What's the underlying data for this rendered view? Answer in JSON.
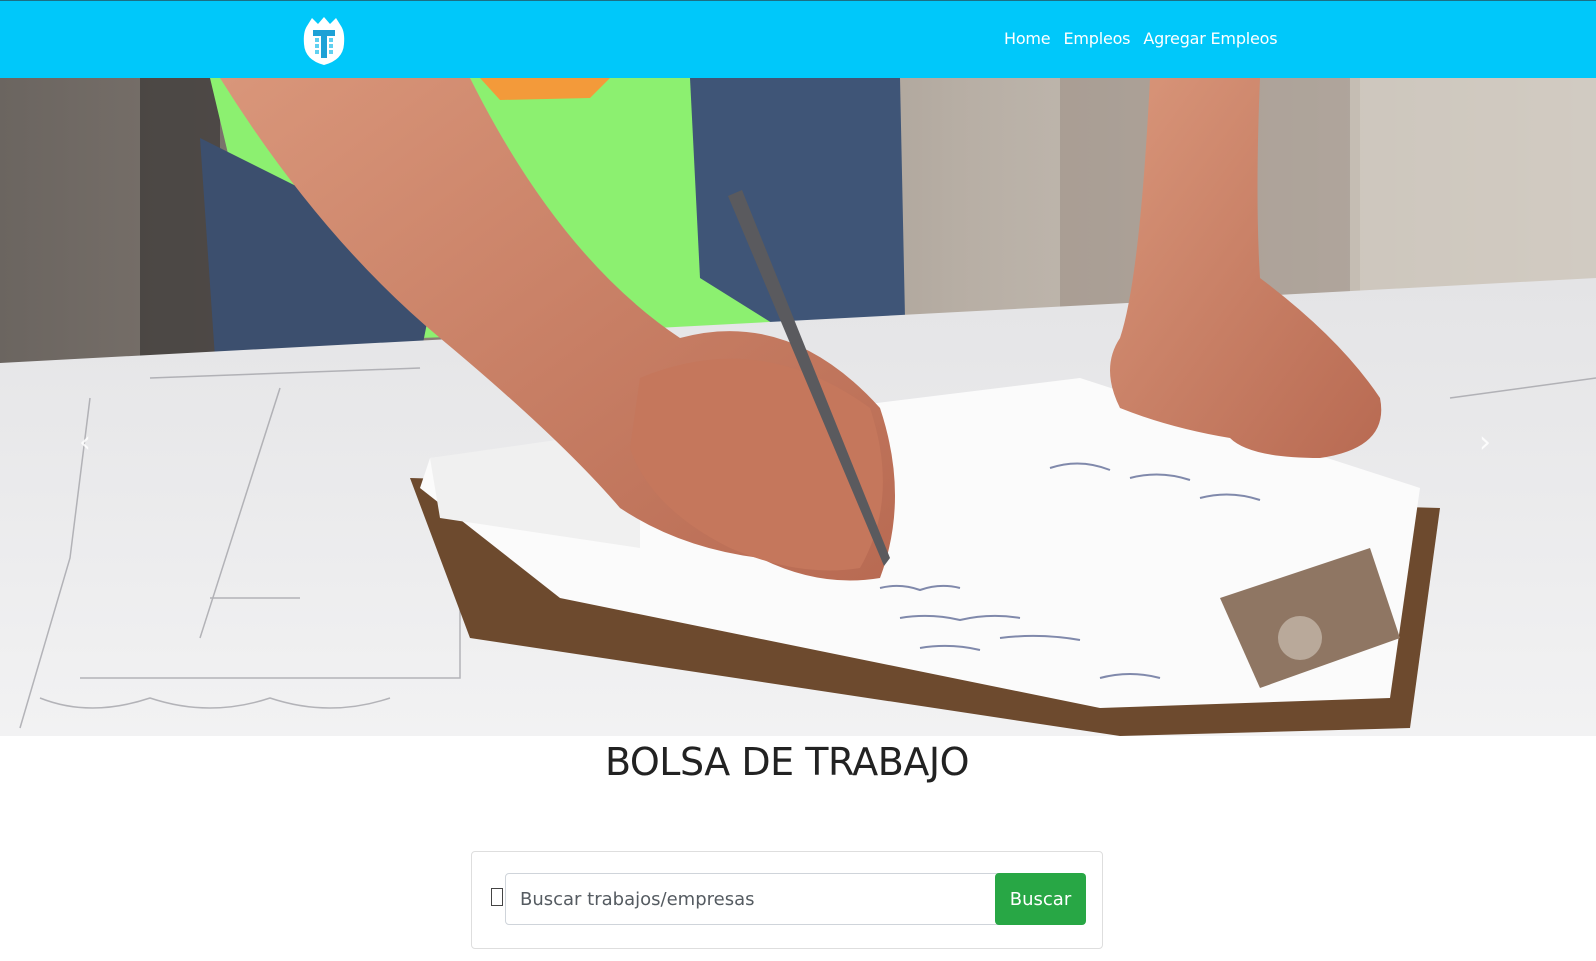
{
  "navbar": {
    "logo_icon": "tower-t-logo-icon",
    "links": [
      {
        "label": "Home"
      },
      {
        "label": "Empleos"
      },
      {
        "label": "Agregar Empleos"
      }
    ],
    "background_color": "#00c8fa"
  },
  "hero": {
    "image_icon": "hero-photo-worker-writing-clipboard",
    "prev_label": "‹",
    "next_label": "›"
  },
  "main": {
    "title": "BOLSA DE TRABAJO"
  },
  "search": {
    "placeholder": "Buscar trabajos/empresas",
    "button_label": "Buscar",
    "button_color": "#28a745"
  }
}
